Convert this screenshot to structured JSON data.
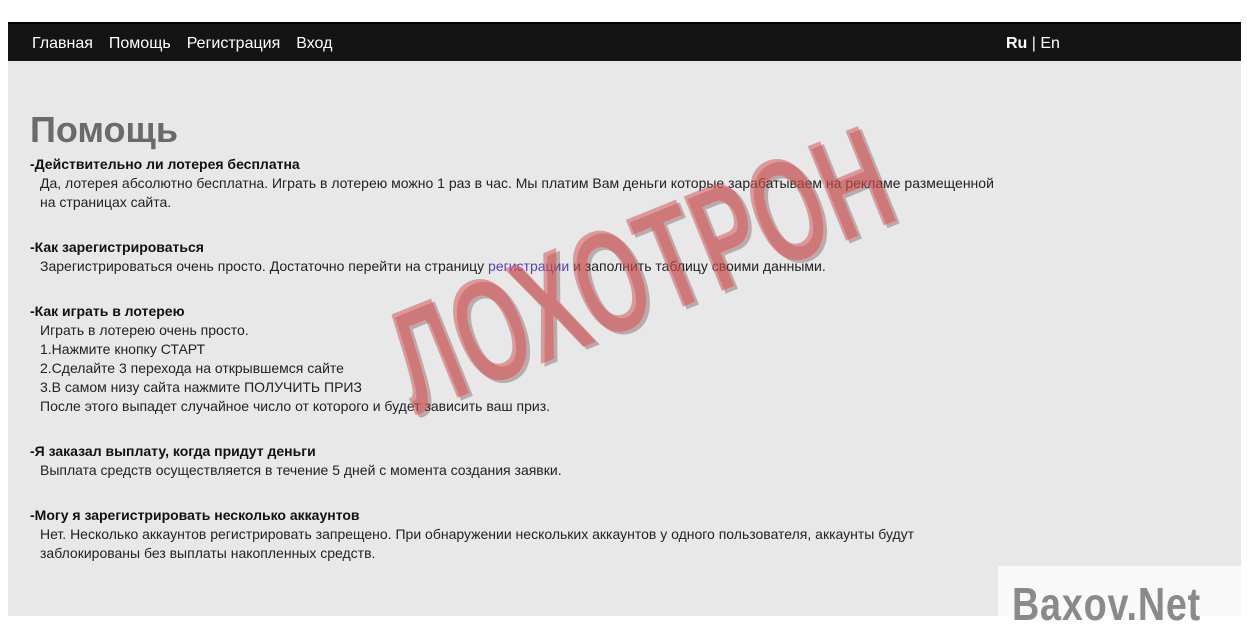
{
  "nav": {
    "links": [
      "Главная",
      "Помощь",
      "Регистрация",
      "Вход"
    ],
    "lang_ru": "Ru",
    "lang_sep": " | ",
    "lang_en": "En"
  },
  "page": {
    "title": "Помощь"
  },
  "faq": [
    {
      "question": "-Действительно ли лотерея бесплатна",
      "answer_lines": [
        "Да, лотерея абсолютно бесплатна. Играть в лотерею можно 1 раз в час. Мы платим Вам деньги которые зарабатываем на рекламе размещенной на страницах сайта."
      ]
    },
    {
      "question": "-Как зарегистрироваться",
      "answer_before_link": "Зарегистрироваться очень просто. Достаточно перейти на страницу ",
      "answer_link": "регистрации",
      "answer_after_link": " и заполнить таблицу своими данными."
    },
    {
      "question": "-Как играть в лотерею",
      "answer_lines": [
        "Играть в лотерею очень просто.",
        "1.Нажмите кнопку СТАРТ",
        "2.Сделайте 3 перехода на открывшемся сайте",
        "3.В самом низу сайта нажмите ПОЛУЧИТЬ ПРИЗ",
        "После этого выпадет случайное число от которого и будет зависить ваш приз."
      ]
    },
    {
      "question": "-Я заказал выплату, когда придут деньги",
      "answer_lines": [
        "Выплата средств осуществляется в течение 5 дней с момента создания заявки."
      ]
    },
    {
      "question": "-Могу я зарегистрировать несколько аккаунтов",
      "answer_lines": [
        "Нет. Несколько аккаунтов регистрировать запрещено. При обнаружении нескольких аккаунтов у одного пользователя, аккаунты будут заблокированы без выплаты накопленных средств."
      ]
    }
  ],
  "overlay": {
    "stamp": "ЛОХОТРОН",
    "watermark": "Baxov.Net"
  },
  "colors": {
    "navbar": "#141414",
    "content_bg": "#e8e8e8",
    "link": "#5b3fb4",
    "stamp": "#e84e4e"
  }
}
